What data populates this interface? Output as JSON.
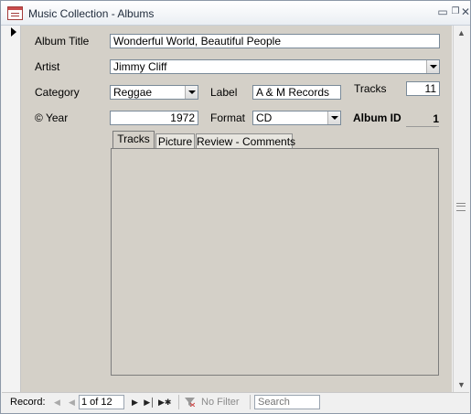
{
  "window": {
    "title": "Music Collection - Albums",
    "minimize_icon": "minimize-icon",
    "restore_icon": "restore-icon",
    "close_icon": "close-icon"
  },
  "form": {
    "album_title_label": "Album Title",
    "album_title_value": "Wonderful World, Beautiful People",
    "artist_label": "Artist",
    "artist_value": "Jimmy Cliff",
    "category_label": "Category",
    "category_value": "Reggae",
    "label_label": "Label",
    "label_value": "A & M Records",
    "tracks_label": "Tracks",
    "tracks_value": "11",
    "year_label": "Year",
    "year_value": "1972",
    "format_label": "Format",
    "format_value": "CD",
    "album_id_label": "Album ID",
    "album_id_value": "1"
  },
  "tabs": [
    {
      "label": "Tracks",
      "active": true
    },
    {
      "label": "Picture",
      "active": false
    },
    {
      "label": "Review - Comments",
      "active": false
    }
  ],
  "navigation": {
    "record_label": "Record:",
    "record_position": "1 of 12",
    "no_filter_label": "No Filter",
    "search_placeholder": "Search"
  },
  "colors": {
    "form_background": "#d4d0c8",
    "window_border": "#8d99a8"
  }
}
